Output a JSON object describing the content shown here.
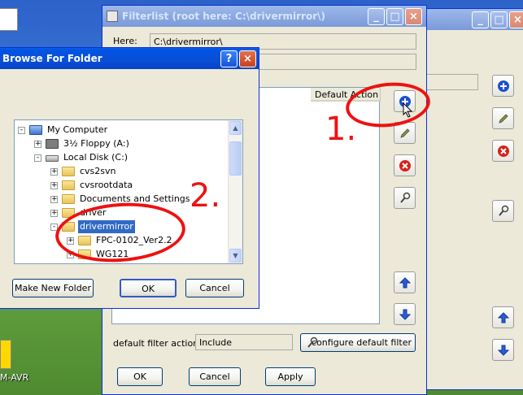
{
  "desktop": {
    "icon1_label": "",
    "icon2_label": "M-AVR"
  },
  "filterlist": {
    "title": "Filterlist (root here: C:\\drivermirror\\)",
    "here_label": "Here:",
    "here_value": "C:\\drivermirror\\",
    "columns": [
      "Default Action"
    ],
    "default_filter_label": "default filter action:",
    "default_filter_value": "Include",
    "configure_button": "configure default filter",
    "ok_button": "OK",
    "cancel_button": "Cancel",
    "apply_button": "Apply"
  },
  "browse": {
    "title": "Browse For Folder",
    "tree": [
      {
        "label": "My Computer",
        "icon": "computer-icon",
        "expander": "-"
      },
      {
        "label": "3½ Floppy (A:)",
        "icon": "floppy-icon",
        "expander": "+"
      },
      {
        "label": "Local Disk (C:)",
        "icon": "disk-icon",
        "expander": "-"
      },
      {
        "label": "cvs2svn",
        "icon": "folder-icon",
        "expander": "+"
      },
      {
        "label": "cvsrootdata",
        "icon": "folder-icon",
        "expander": "+"
      },
      {
        "label": "Documents and Settings",
        "icon": "folder-icon",
        "expander": "+"
      },
      {
        "label": "driver",
        "icon": "folder-icon",
        "expander": "+"
      },
      {
        "label": "drivermirror",
        "icon": "folder-open-icon",
        "expander": "-",
        "selected": true
      },
      {
        "label": "FPC-0102_Ver2.2",
        "icon": "folder-icon",
        "expander": "+"
      },
      {
        "label": "WG121",
        "icon": "folder-icon",
        "expander": "+"
      }
    ],
    "make_new_folder": "Make New Folder",
    "ok_button": "OK",
    "cancel_button": "Cancel"
  },
  "annotations": {
    "step1": "1.",
    "step2": "2.",
    "color": "#e11111"
  }
}
